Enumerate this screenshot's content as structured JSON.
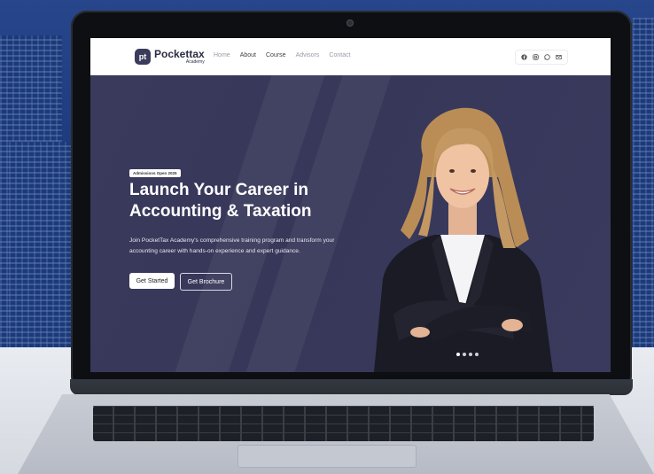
{
  "nav": {
    "logo_mark": "pt",
    "logo_name": "Pockettax",
    "logo_sub": "Academy",
    "menu": [
      "Home",
      "About",
      "Course",
      "Advisors",
      "Contact"
    ]
  },
  "social_icons": [
    "facebook-icon",
    "instagram-icon",
    "whatsapp-icon",
    "mail-icon"
  ],
  "hero": {
    "badge": "Admissions Open 2025",
    "headline_line1": "Launch Your Career in",
    "headline_line2": "Accounting & Taxation",
    "subtext": "Join PocketTax Academy's comprehensive training program and transform your accounting career with hands-on experience and expert guidance.",
    "primary_button": "Get Started",
    "secondary_button": "Get Brochure"
  },
  "colors": {
    "hero_bg": "#3b3b5c",
    "nav_bg": "#ffffff",
    "text_light": "#ffffff"
  }
}
